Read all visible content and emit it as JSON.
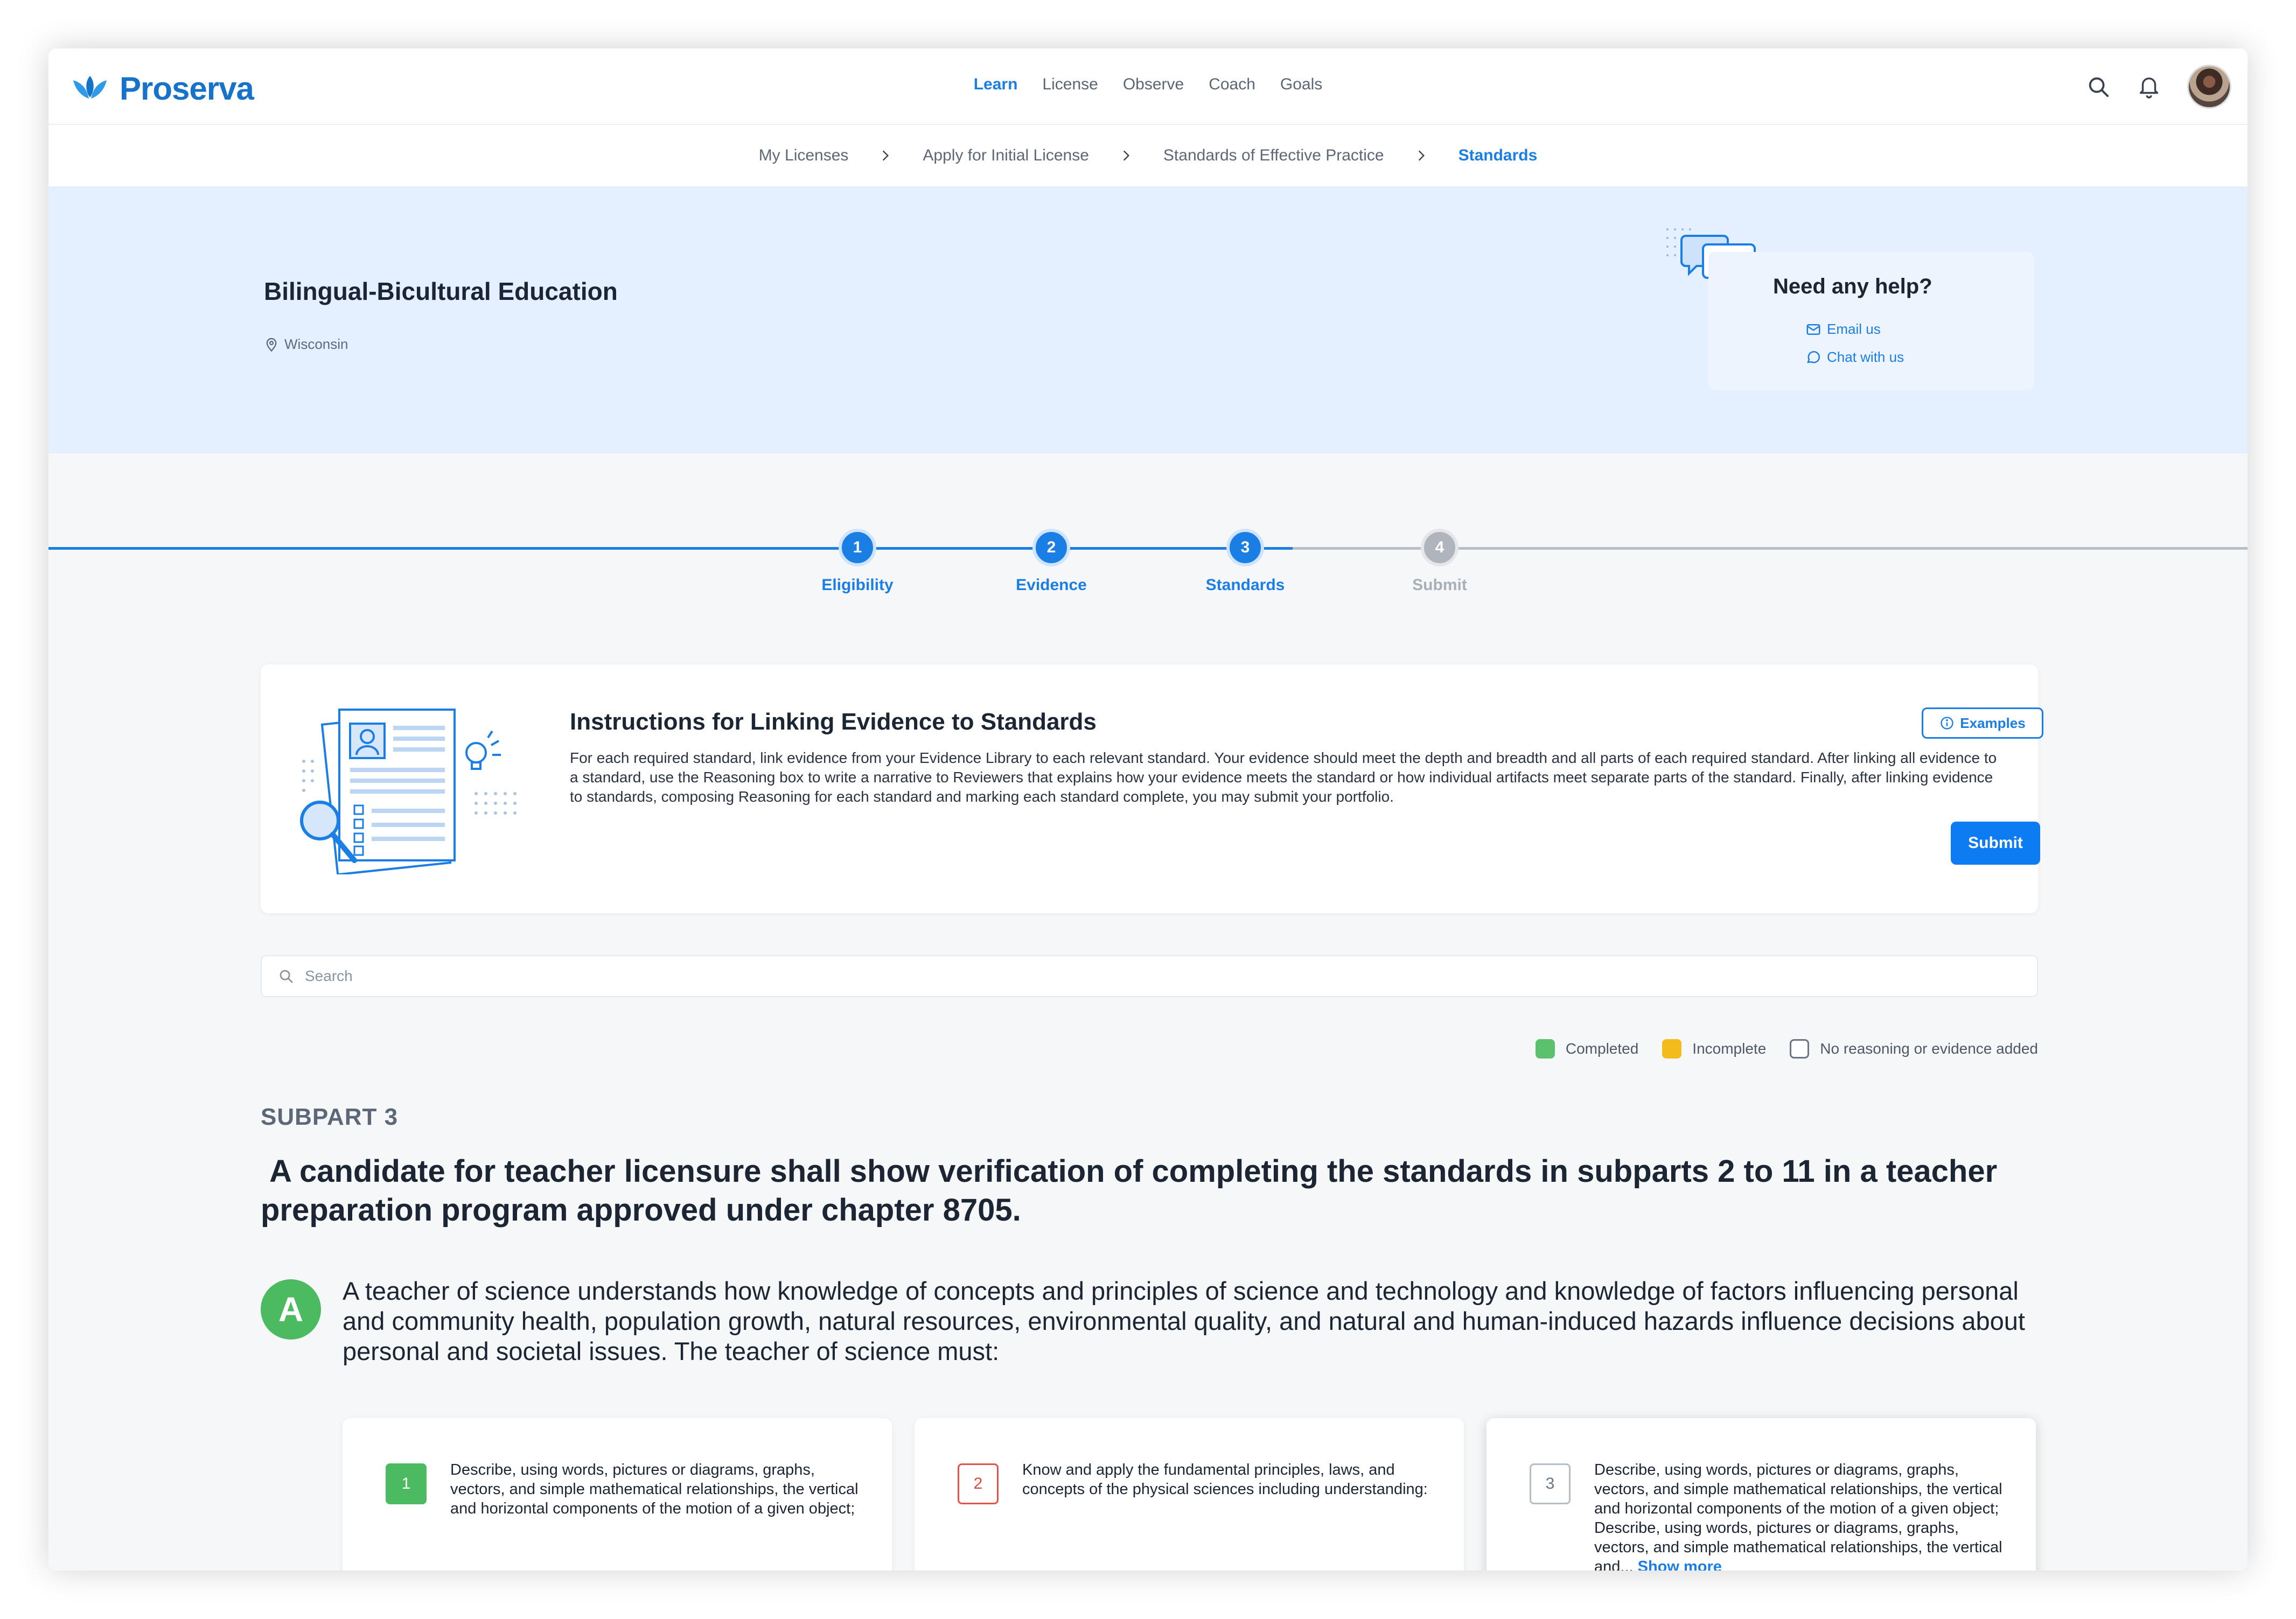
{
  "brand": {
    "name": "Proserva",
    "color": "#1673c9"
  },
  "nav": {
    "items": [
      {
        "label": "Learn",
        "active": true
      },
      {
        "label": "License",
        "active": false
      },
      {
        "label": "Observe",
        "active": false
      },
      {
        "label": "Coach",
        "active": false
      },
      {
        "label": "Goals",
        "active": false
      }
    ]
  },
  "header_icons": [
    "search-icon",
    "bell-icon",
    "user-avatar"
  ],
  "breadcrumb": [
    {
      "label": "My Licenses"
    },
    {
      "label": "Apply for Initial License"
    },
    {
      "label": "Standards of Effective Practice"
    },
    {
      "label": "Standards",
      "active": true
    }
  ],
  "hero": {
    "title": "Bilingual-Bicultural Education",
    "location": "Wisconsin",
    "help": {
      "title": "Need any help?",
      "email_label": "Email us",
      "chat_label": "Chat with us"
    }
  },
  "stepper": {
    "steps": [
      {
        "number": "1",
        "label": "Eligibility",
        "state": "complete"
      },
      {
        "number": "2",
        "label": "Evidence",
        "state": "complete"
      },
      {
        "number": "3",
        "label": "Standards",
        "state": "current"
      },
      {
        "number": "4",
        "label": "Submit",
        "state": "upcoming"
      }
    ]
  },
  "instructions": {
    "title": "Instructions for Linking Evidence to Standards",
    "body": "For each required standard, link evidence from your Evidence Library to each relevant standard. Your evidence should meet the depth and breadth and all parts of each required standard. After linking all evidence to a standard, use the Reasoning box to write a narrative to Reviewers that explains how your evidence meets the standard or how individual artifacts meet separate parts of the standard. Finally, after linking evidence to standards, composing Reasoning for each standard and marking each standard complete, you may submit your portfolio.",
    "examples_label": "Examples",
    "submit_label": "Submit"
  },
  "search": {
    "placeholder": "Search",
    "value": ""
  },
  "legend": [
    {
      "label": "Completed",
      "color": "#5cc16c"
    },
    {
      "label": "Incomplete",
      "color": "#f3bb1c"
    },
    {
      "label": "No reasoning or evidence added",
      "color": "#ffffff"
    }
  ],
  "subpart": {
    "label": "SUBPART 3",
    "title": " A candidate for teacher licensure shall show verification of completing the standards in subparts 2 to 11 in a teacher preparation program approved under chapter 8705."
  },
  "standard": {
    "letter": "A",
    "text": "A teacher of science understands how knowledge of concepts and principles of science and technology and knowledge of factors influencing personal and community health, population growth, natural resources, environmental quality, and natural and human-induced hazards influence decisions about personal and societal issues. The teacher of science must:",
    "items": [
      {
        "number": "1",
        "status": "completed",
        "text": "Describe, using words, pictures or diagrams, graphs, vectors, and simple mathematical relationships, the vertical and horizontal components of the motion of a given object;"
      },
      {
        "number": "2",
        "status": "incomplete",
        "text": "Know and apply the fundamental principles, laws, and concepts of the physical sciences including understanding:"
      },
      {
        "number": "3",
        "status": "none",
        "text": "Describe, using words, pictures or diagrams, graphs, vectors, and simple mathematical relationships, the vertical and horizontal components of the motion of a given object; Describe, using words, pictures or diagrams, graphs, vectors, and simple mathematical relationships, the vertical and...",
        "show_more": "Show more"
      }
    ]
  },
  "colors": {
    "accent": "#1a7ee4",
    "completed": "#4cba60",
    "incomplete_border": "#e0534d",
    "hero_bg": "#e4efff"
  }
}
